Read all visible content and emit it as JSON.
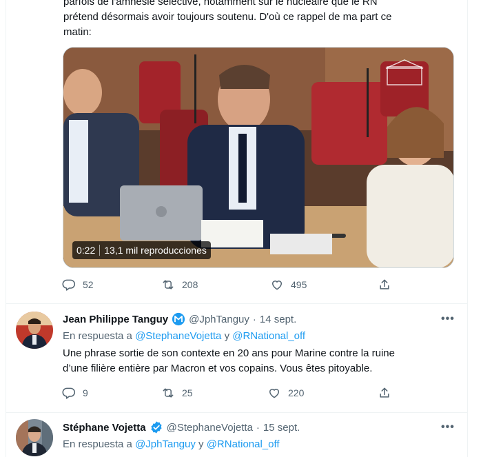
{
  "tweet1": {
    "text_lines": [
      "parfois de l'amnésie sélective, notamment sur le nucléaire que le RN",
      "prétend désormais avoir toujours soutenu. D'où ce rappel de ma part ce",
      "matin:"
    ],
    "video": {
      "duration": "0:22",
      "views": "13,1 mil reproducciones"
    },
    "actions": {
      "replies": "52",
      "retweets": "208",
      "likes": "495"
    }
  },
  "reply1": {
    "name": "Jean Philippe Tanguy",
    "handle": "@JphTanguy",
    "separator": "·",
    "date": "14 sept.",
    "reply_prefix": "En respuesta a",
    "reply_to_1": "@StephaneVojetta",
    "reply_conj": "y",
    "reply_to_2": "@RNational_off",
    "text_lines": [
      "Une phrase sortie de son contexte en 20 ans pour Marine contre la ruine",
      "d’une filière entière par Macron et vos copains. Vous êtes pitoyable."
    ],
    "actions": {
      "replies": "9",
      "retweets": "25",
      "likes": "220"
    },
    "more": "•••"
  },
  "reply2": {
    "name": "Stéphane Vojetta",
    "handle": "@StephaneVojetta",
    "separator": "·",
    "date": "15 sept.",
    "reply_prefix": "En respuesta a",
    "reply_to_1": "@JphTanguy",
    "reply_conj": "y",
    "reply_to_2": "@RNational_off",
    "more": "•••"
  },
  "colors": {
    "accent": "#1d9bf0",
    "muted": "#536471",
    "text": "#0f1419",
    "border": "#eff3f4"
  }
}
